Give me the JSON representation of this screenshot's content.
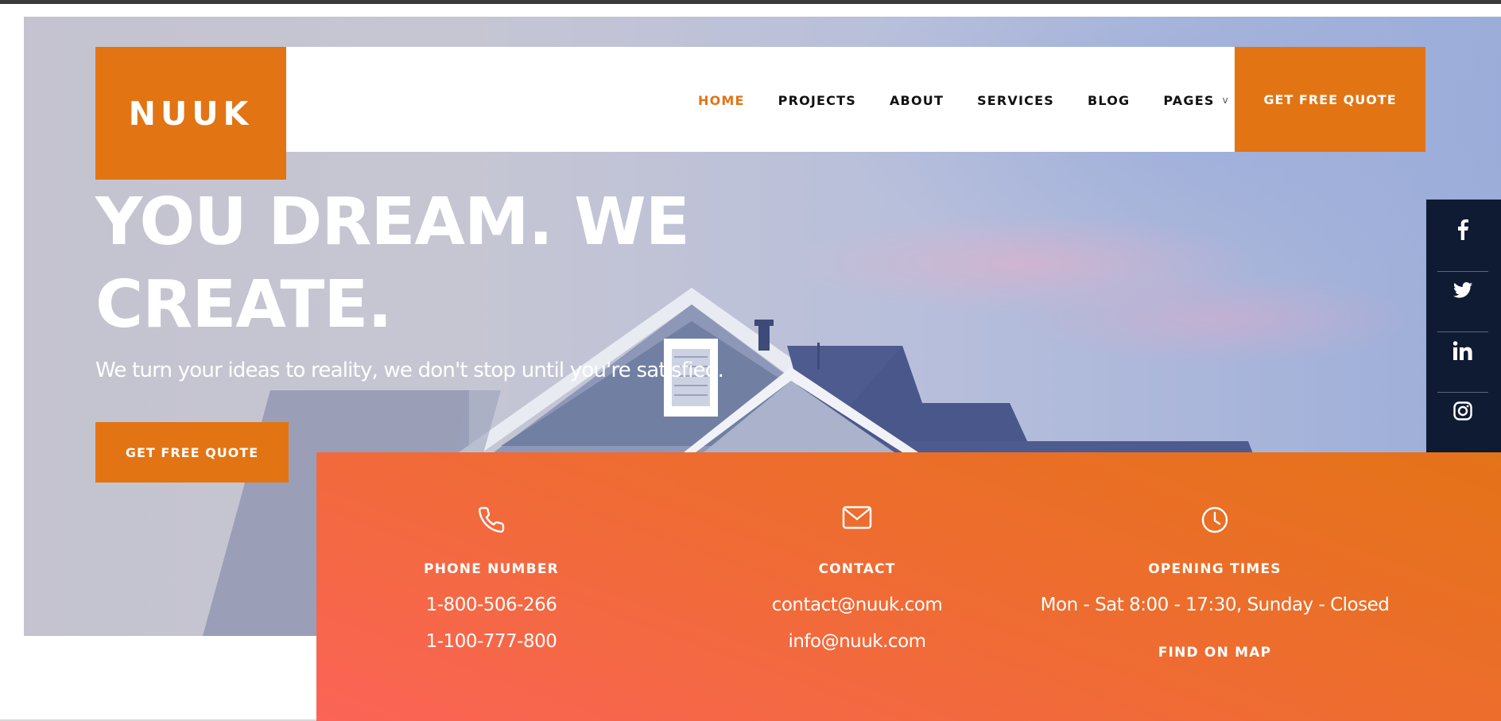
{
  "brand": {
    "logo": "NUUK",
    "accent": "#e37413",
    "dark": "#0f1a33"
  },
  "nav": {
    "items": [
      {
        "label": "HOME",
        "active": true
      },
      {
        "label": "PROJECTS"
      },
      {
        "label": "ABOUT"
      },
      {
        "label": "SERVICES"
      },
      {
        "label": "BLOG"
      },
      {
        "label": "PAGES",
        "has_dropdown": true,
        "chevron": "v"
      }
    ],
    "cta": "GET FREE QUOTE"
  },
  "hero": {
    "title_line1": "YOU DREAM. WE",
    "title_line2": "CREATE.",
    "subtitle": "We turn your ideas to reality, we don't stop until you're satisfied.",
    "cta": "GET FREE QUOTE"
  },
  "social": {
    "icons": [
      "facebook-icon",
      "twitter-icon",
      "linkedin-icon",
      "instagram-icon"
    ]
  },
  "info": {
    "phone": {
      "icon": "phone-icon",
      "title": "PHONE NUMBER",
      "line1": "1-800-506-266",
      "line2": "1-100-777-800"
    },
    "contact": {
      "icon": "mail-icon",
      "title": "CONTACT",
      "line1": "contact@nuuk.com",
      "line2": "info@nuuk.com"
    },
    "hours": {
      "icon": "clock-icon",
      "title": "OPENING TIMES",
      "line1": "Mon - Sat 8:00 - 17:30, Sunday - Closed",
      "link": "FIND ON MAP"
    }
  }
}
